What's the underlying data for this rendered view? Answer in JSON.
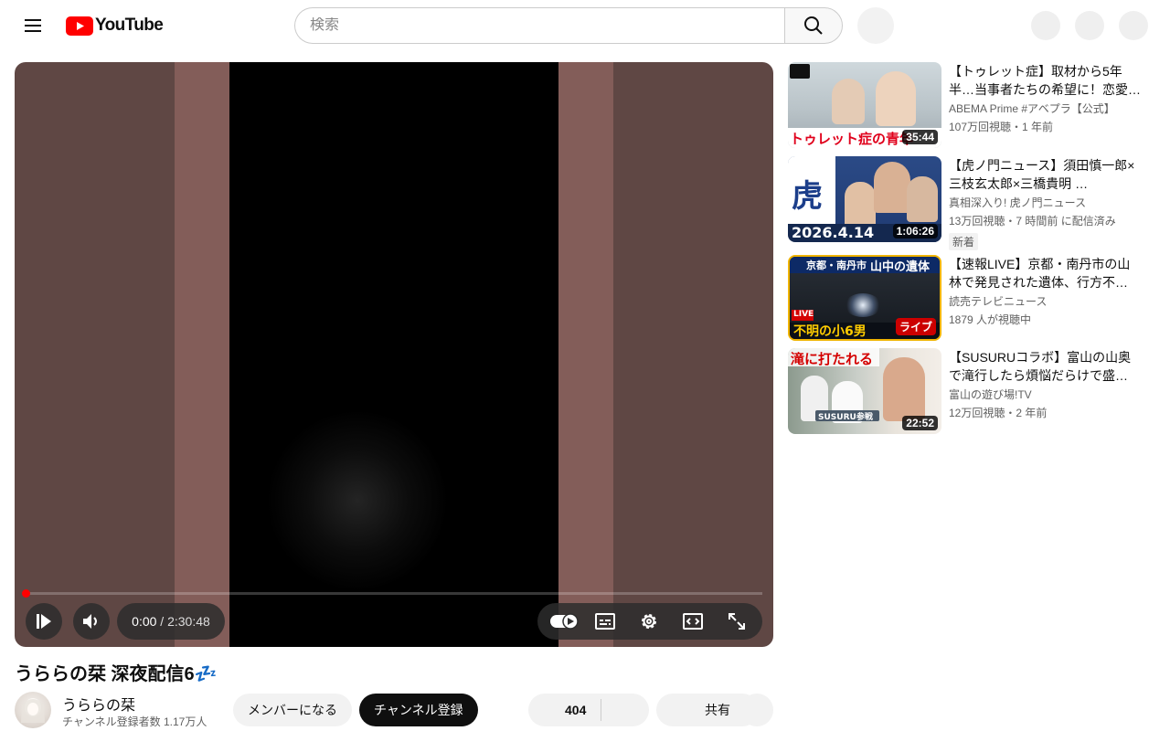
{
  "header": {
    "search_placeholder": "検索",
    "logo_text": "YouTube"
  },
  "player": {
    "current_time": "0:00",
    "separator": " / ",
    "duration": "2:30:48",
    "progress": 0,
    "autoplay_on": true
  },
  "video": {
    "title": "うららの栞 深夜配信6💤",
    "channel_name": "うららの栞",
    "subscriber_count": "チャンネル登録者数 1.17万人",
    "member_label": "メンバーになる",
    "subscribe_label": "チャンネル登録",
    "like_count": "404",
    "share_label": "共有"
  },
  "recommendations": [
    {
      "title": "【トゥレット症】取材から5年半…当事者たちの希望に！恋愛…",
      "channel": "ABEMA Prime #アベプラ【公式】",
      "meta": "107万回視聴・1 年前",
      "duration": "35:44",
      "thumb_caption": "トゥレット症の青年",
      "thumb_logo": "ABEMA news"
    },
    {
      "title": "【虎ノ門ニュース】須田慎一郎×三枝玄太郎×三橋貴明 …",
      "channel": "真相深入り! 虎ノ門ニュース",
      "meta": "13万回視聴・7 時間前 に配信済み",
      "badge": "新着",
      "duration": "1:06:26",
      "thumb_caption": "2026.4.14",
      "thumb_kanji": "虎"
    },
    {
      "title": "【速報LIVE】京都・南丹市の山林で発見された遺体、行方不…",
      "channel": "読売テレビニュース",
      "meta": "1879 人が視聴中",
      "live_label": "ライブ",
      "thumb_top": "京都・南丹市",
      "thumb_top2": "山中の遺体",
      "thumb_bottom": "不明の小6男",
      "thumb_live_tag": "LIVE"
    },
    {
      "title": "【SUSURUコラボ】富山の山奥で滝行したら煩悩だらけで盛…",
      "channel": "富山の遊び場!TV",
      "meta": "12万回視聴・2 年前",
      "duration": "22:52",
      "thumb_caption": "滝に打たれる",
      "thumb_tag": "SUSURU参戦"
    }
  ],
  "colors": {
    "accent_red": "#ff0000",
    "player_bg": "#5f4744",
    "player_band": "#835d59"
  }
}
